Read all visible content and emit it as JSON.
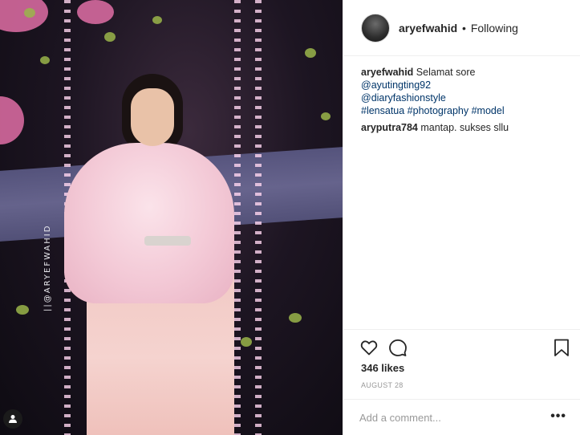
{
  "header": {
    "username": "aryefwahid",
    "separator": "•",
    "follow_status": "Following"
  },
  "photo": {
    "watermark": "||@ARYEFWAHID"
  },
  "caption": {
    "username": "aryefwahid",
    "text": "Selamat sore",
    "mentions": [
      "@ayutingting92",
      "@diaryfashionstyle"
    ],
    "hashtags": "#lensatua #photography #model"
  },
  "comments": [
    {
      "username": "aryputra784",
      "text": "mantap. sukses sllu"
    }
  ],
  "stats": {
    "likes": "346 likes",
    "date": "AUGUST 28"
  },
  "comment_box": {
    "placeholder": "Add a comment...",
    "more_label": "•••"
  },
  "icons": {
    "like": "heart-icon",
    "comment": "comment-bubble-icon",
    "save": "bookmark-icon",
    "tag": "user-tag-icon"
  },
  "colors": {
    "link": "#003569",
    "muted": "#999999",
    "text": "#262626",
    "border": "#efefef"
  }
}
